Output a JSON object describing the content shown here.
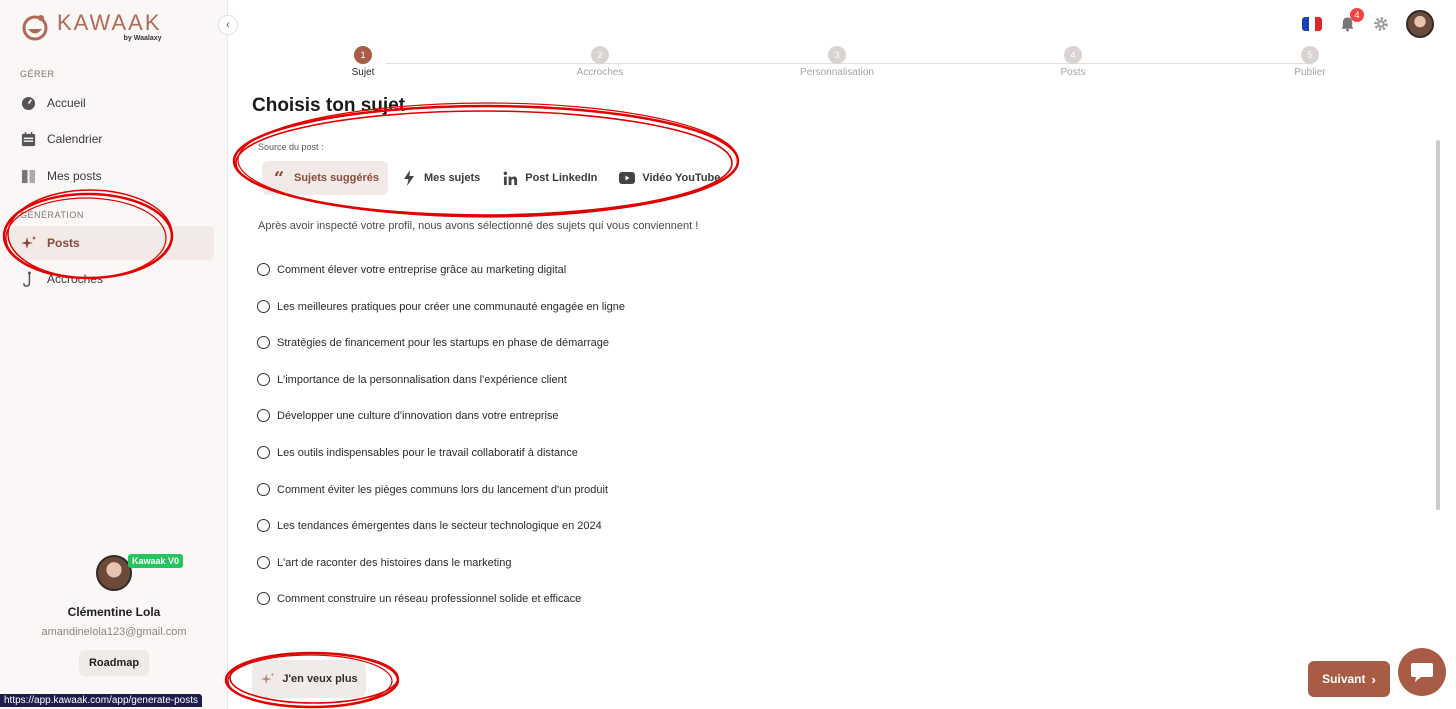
{
  "brand": {
    "name": "KAWAAK",
    "by": "by Waalaxy",
    "accent_color": "#a85c46",
    "highlight_color": "#e00000"
  },
  "sidebar": {
    "section_manage": "GÉRER",
    "section_generation": "GÉNÉRATION",
    "items": [
      {
        "label": "Accueil",
        "icon": "dashboard-icon"
      },
      {
        "label": "Calendrier",
        "icon": "calendar-icon"
      },
      {
        "label": "Mes posts",
        "icon": "posts-icon"
      },
      {
        "label": "Posts",
        "icon": "sparkles-icon",
        "active": true
      },
      {
        "label": "Accroches",
        "icon": "hook-icon"
      }
    ],
    "profile": {
      "badge": "Kawaak V0",
      "name": "Clémentine Lola",
      "email": "amandinelola123@gmail.com",
      "roadmap": "Roadmap"
    }
  },
  "topbar": {
    "notification_count": "4",
    "language": "fr"
  },
  "stepper": [
    {
      "number": "1",
      "label": "Sujet",
      "active": true
    },
    {
      "number": "2",
      "label": "Accroches"
    },
    {
      "number": "3",
      "label": "Personnalisation"
    },
    {
      "number": "4",
      "label": "Posts"
    },
    {
      "number": "5",
      "label": "Publier"
    }
  ],
  "main": {
    "title": "Choisis ton sujet",
    "source_label": "Source du post :",
    "source_tabs": [
      {
        "label": "Sujets suggérés",
        "icon": "quote-icon",
        "active": true
      },
      {
        "label": "Mes sujets",
        "icon": "bolt-icon"
      },
      {
        "label": "Post LinkedIn",
        "icon": "linkedin-icon"
      },
      {
        "label": "Vidéo YouTube",
        "icon": "youtube-icon"
      }
    ],
    "intro": "Après avoir inspecté votre profil, nous avons sélectionné des sujets qui vous conviennent !",
    "topics": [
      "Comment élever votre entreprise grâce au marketing digital",
      "Les meilleures pratiques pour créer une communauté engagée en ligne",
      "Stratégies de financement pour les startups en phase de démarrage",
      "L'importance de la personnalisation dans l'expérience client",
      "Développer une culture d'innovation dans votre entreprise",
      "Les outils indispensables pour le travail collaboratif à distance",
      "Comment éviter les pièges communs lors du lancement d'un produit",
      "Les tendances émergentes dans le secteur technologique en 2024",
      "L'art de raconter des histoires dans le marketing",
      "Comment construire un réseau professionnel solide et efficace"
    ],
    "more_button": "J'en veux plus",
    "next_button": "Suivant"
  },
  "status_bar_url": "https://app.kawaak.com/app/generate-posts"
}
